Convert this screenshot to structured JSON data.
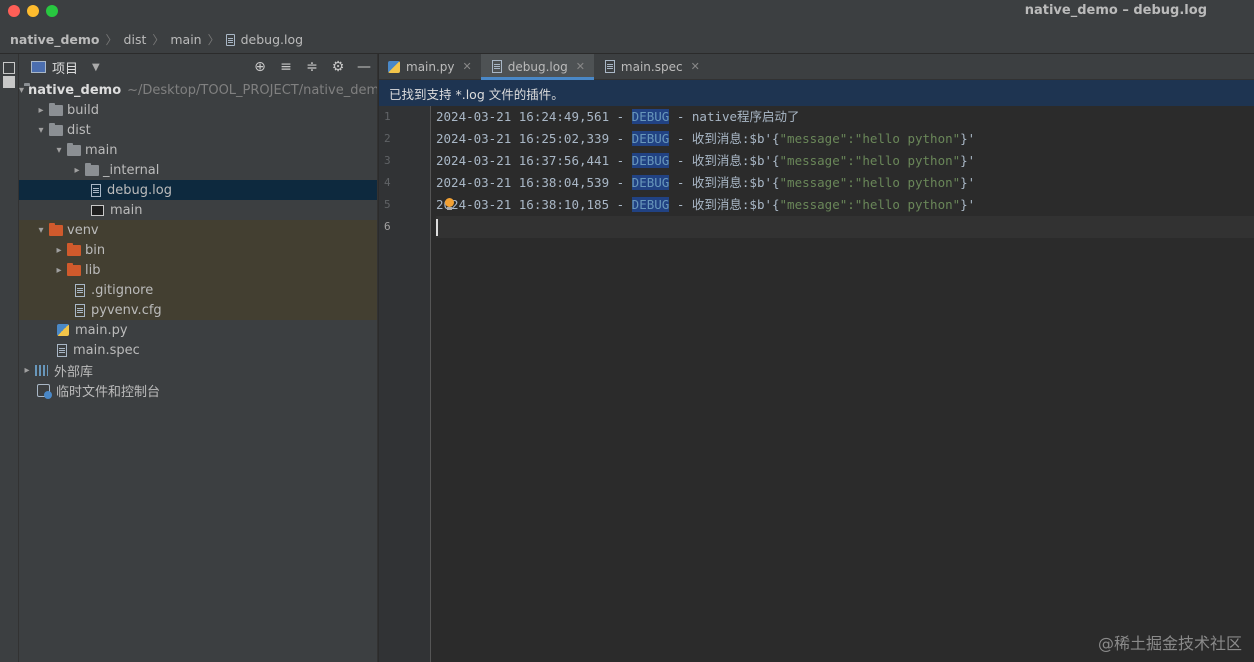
{
  "window": {
    "title": "native_demo – debug.log"
  },
  "breadcrumb": {
    "items": [
      "native_demo",
      "dist",
      "main",
      "debug.log"
    ]
  },
  "stripe": {
    "label": "项目"
  },
  "project_panel": {
    "title": "项目",
    "tools": {
      "locate": "⊕",
      "expand": "≡",
      "collapse": "≑",
      "settings": "⚙",
      "hide": "—"
    },
    "root": {
      "name": "native_demo",
      "path": "~/Desktop/TOOL_PROJECT/native_demo"
    },
    "items": {
      "build": "build",
      "dist": "dist",
      "main_dir": "main",
      "internal": "_internal",
      "debug_log": "debug.log",
      "main_exec": "main",
      "venv": "venv",
      "bin": "bin",
      "lib": "lib",
      "gitignore": ".gitignore",
      "pyvenv": "pyvenv.cfg",
      "main_py": "main.py",
      "main_spec": "main.spec",
      "external_libs": "外部库",
      "scratches": "临时文件和控制台"
    }
  },
  "tabs": [
    {
      "label": "main.py"
    },
    {
      "label": "debug.log"
    },
    {
      "label": "main.spec"
    }
  ],
  "notice": {
    "text": "已找到支持 *.log 文件的插件。"
  },
  "editor": {
    "line_numbers": [
      "1",
      "2",
      "3",
      "4",
      "5",
      "6"
    ],
    "lines": [
      {
        "ts": "2024-03-21 16:24:49,561 - ",
        "level": "DEBUG",
        "msg": " - native程序启动了",
        "str": "",
        "tail": ""
      },
      {
        "ts": "2024-03-21 16:25:02,339 - ",
        "level": "DEBUG",
        "msg": " - 收到消息:$b'{",
        "str": "\"message\":\"hello python\"",
        "tail": "}'"
      },
      {
        "ts": "2024-03-21 16:37:56,441 - ",
        "level": "DEBUG",
        "msg": " - 收到消息:$b'{",
        "str": "\"message\":\"hello python\"",
        "tail": "}'"
      },
      {
        "ts": "2024-03-21 16:38:04,539 - ",
        "level": "DEBUG",
        "msg": " - 收到消息:$b'{",
        "str": "\"message\":\"hello python\"",
        "tail": "}'"
      },
      {
        "ts": "2024-03-21 16:38:10,185 - ",
        "level": "DEBUG",
        "msg": " - 收到消息:$b'{",
        "str": "\"message\":\"hello python\"",
        "tail": "}'"
      }
    ]
  },
  "watermark": {
    "text": "@稀土掘金技术社区"
  },
  "colors": {
    "selection": "#0d293e",
    "venv_highlight": "#433f31",
    "tab_accent": "#4a88c7",
    "notice_bg": "#1e3451",
    "debug_highlight": "#214283"
  }
}
